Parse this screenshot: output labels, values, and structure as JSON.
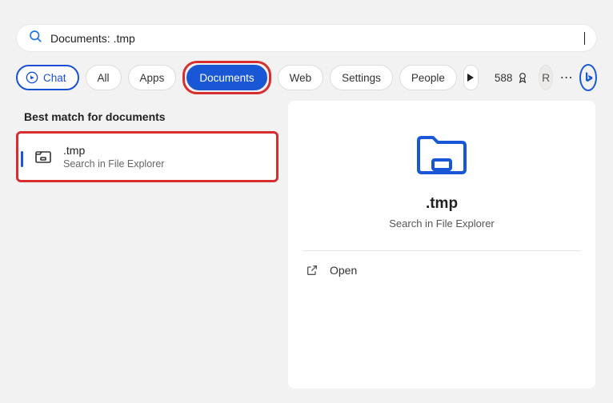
{
  "search": {
    "text": "Documents: .tmp"
  },
  "tabs": {
    "chat": "Chat",
    "all": "All",
    "apps": "Apps",
    "documents": "Documents",
    "web": "Web",
    "settings": "Settings",
    "people": "People"
  },
  "toolbar": {
    "points": "588",
    "avatar_initial": "R"
  },
  "results": {
    "section_label": "Best match for documents",
    "item": {
      "title": ".tmp",
      "subtitle": "Search in File Explorer"
    }
  },
  "detail": {
    "title": ".tmp",
    "subtitle": "Search in File Explorer",
    "actions": {
      "open": "Open"
    }
  }
}
